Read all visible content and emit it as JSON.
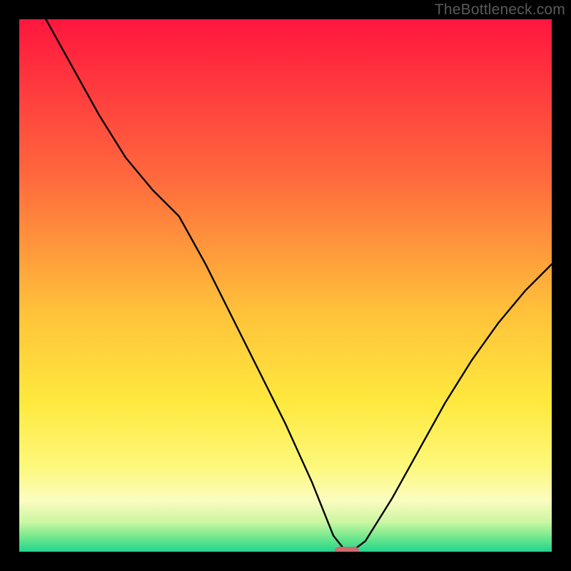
{
  "watermark": {
    "text": "TheBottleneck.com"
  },
  "chart_data": {
    "type": "line",
    "title": "",
    "xlabel": "",
    "ylabel": "",
    "xlim": [
      0,
      100
    ],
    "ylim": [
      0,
      100
    ],
    "gradient_stops": [
      {
        "offset": 0,
        "color": "#ff163e"
      },
      {
        "offset": 0.3,
        "color": "#ff6a3d"
      },
      {
        "offset": 0.55,
        "color": "#ffc23a"
      },
      {
        "offset": 0.72,
        "color": "#ffe93e"
      },
      {
        "offset": 0.84,
        "color": "#fdf87c"
      },
      {
        "offset": 0.905,
        "color": "#fbfcc0"
      },
      {
        "offset": 0.945,
        "color": "#c9f6a1"
      },
      {
        "offset": 0.975,
        "color": "#6be68c"
      },
      {
        "offset": 1.0,
        "color": "#21d48e"
      }
    ],
    "series": [
      {
        "name": "bottleneck-curve",
        "x": [
          5,
          10,
          15,
          20,
          25,
          30,
          35,
          40,
          45,
          50,
          55,
          59,
          61,
          63,
          65,
          70,
          75,
          80,
          85,
          90,
          95,
          100
        ],
        "y": [
          100,
          91,
          82,
          74,
          68,
          63,
          54,
          44,
          34,
          24,
          13,
          3,
          0.5,
          0.5,
          2,
          10,
          19,
          28,
          36,
          43,
          49,
          54
        ]
      }
    ],
    "marker": {
      "x": 61.5,
      "y": 0.2,
      "w": 4.5,
      "h": 1.6,
      "color": "#cf6a6f"
    }
  }
}
